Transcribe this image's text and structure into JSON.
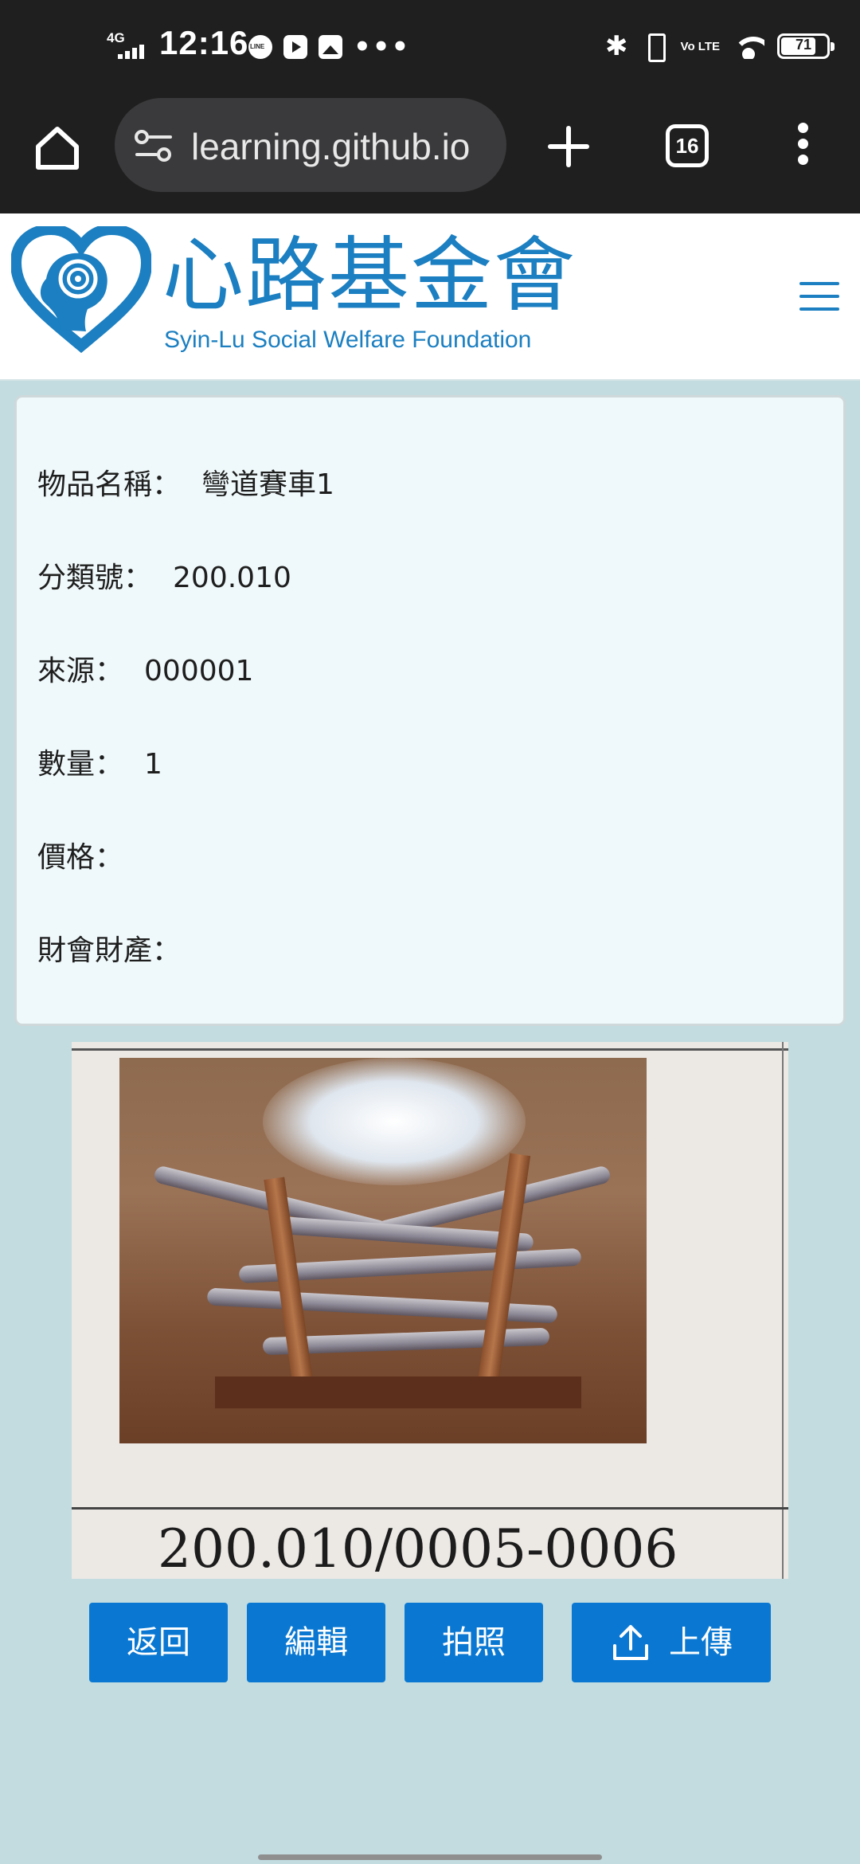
{
  "status_bar": {
    "network": "4G",
    "time": "12:16",
    "notifications": [
      "line-icon",
      "youtube-icon",
      "gallery-icon"
    ],
    "more_indicator": "•••",
    "bluetooth": "✱",
    "volte": "Vo LTE",
    "battery_level": "71"
  },
  "browser": {
    "url": "learning.github.io",
    "tab_count": "16"
  },
  "site": {
    "name_zh": "心路基金會",
    "name_en": "Syin-Lu Social Welfare Foundation",
    "brand_color": "#1b7fc1"
  },
  "item": {
    "fields": [
      {
        "label": "物品名稱：",
        "value": "彎道賽車1"
      },
      {
        "label": "分類號：",
        "value": "200.010"
      },
      {
        "label": "來源：",
        "value": "000001"
      },
      {
        "label": "數量：",
        "value": "1"
      },
      {
        "label": "價格：",
        "value": ""
      },
      {
        "label": "財會財產：",
        "value": ""
      }
    ],
    "photo_caption": "200.010/0005-0006"
  },
  "actions": {
    "back": "返回",
    "edit": "編輯",
    "photo": "拍照",
    "upload": "上傳",
    "button_color": "#0a78d2"
  }
}
